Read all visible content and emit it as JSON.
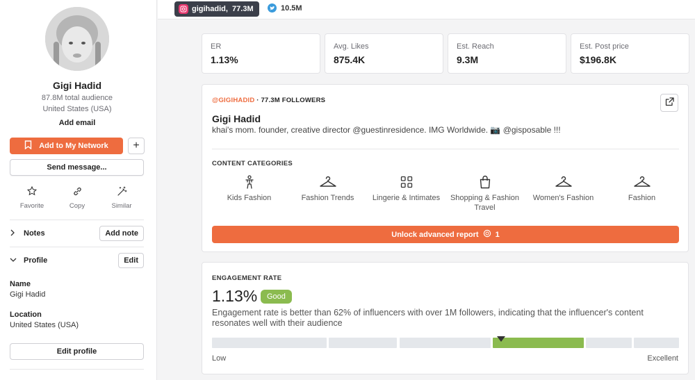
{
  "profile": {
    "name": "Gigi Hadid",
    "audience": "87.8M total audience",
    "location": "United States (USA)",
    "add_email": "Add email"
  },
  "actions": {
    "add_network": "Add to My Network",
    "plus": "+",
    "send_message": "Send message...",
    "favorite": "Favorite",
    "copy": "Copy",
    "similar": "Similar"
  },
  "sections": {
    "notes": "Notes",
    "add_note": "Add note",
    "profile": "Profile",
    "edit": "Edit"
  },
  "fields": {
    "name_label": "Name",
    "name_value": "Gigi Hadid",
    "location_label": "Location",
    "location_value": "United States (USA)",
    "edit_profile": "Edit profile"
  },
  "topbar": {
    "instagram": "gigihadid,  77.3M",
    "twitter": "10.5M"
  },
  "stats": [
    {
      "label": "ER",
      "value": "1.13%"
    },
    {
      "label": "Avg. Likes",
      "value": "875.4K"
    },
    {
      "label": "Est. Reach",
      "value": "9.3M"
    },
    {
      "label": "Est. Post price",
      "value": "$196.8K"
    }
  ],
  "card": {
    "handle": "@GIGIHADID",
    "followers": " · 77.3M FOLLOWERS",
    "name": "Gigi Hadid",
    "bio": "khai's mom. founder, creative director @guestinresidence. IMG Worldwide. 📷 @gisposable !!!",
    "categories_title": "CONTENT CATEGORIES",
    "categories": [
      {
        "label": "Kids Fashion",
        "icon": "child-icon"
      },
      {
        "label": "Fashion Trends",
        "icon": "hanger-icon"
      },
      {
        "label": "Lingerie & Intimates",
        "icon": "grid-icon"
      },
      {
        "label": "Shopping & Fashion Travel",
        "icon": "shopping-bag-icon"
      },
      {
        "label": "Women's Fashion",
        "icon": "hanger-icon"
      },
      {
        "label": "Fashion",
        "icon": "hanger-icon"
      }
    ],
    "unlock_label": "Unlock advanced report",
    "unlock_count": "1"
  },
  "engagement": {
    "title": "ENGAGEMENT RATE",
    "value": "1.13%",
    "badge": "Good",
    "description": "Engagement rate is better than 62% of influencers with over 1M followers, indicating that the influencer's content resonates well with their audience",
    "low": "Low",
    "high": "Excellent"
  },
  "colors": {
    "accent": "#ee6c3f",
    "good": "#8bbb4f",
    "instagram": "#e8386f",
    "twitter": "#3a9bdc"
  }
}
